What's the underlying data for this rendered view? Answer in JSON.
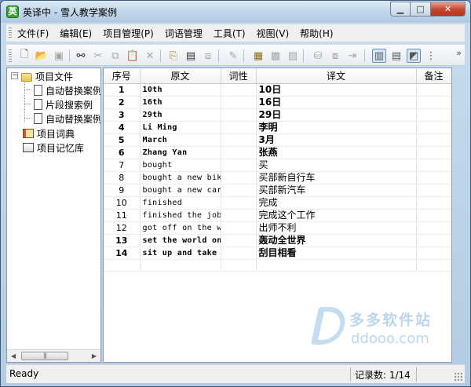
{
  "window": {
    "title": "英译中 - 雪人教学案例",
    "app_icon_letter": "英"
  },
  "menu": [
    "文件(F)",
    "编辑(E)",
    "项目管理(P)",
    "词语管理",
    "工具(T)",
    "视图(V)",
    "帮助(H)"
  ],
  "toolbar": {
    "icons": [
      "new-file-icon",
      "open-folder-icon",
      "save-icon",
      "find-icon",
      "cut-icon",
      "copy-icon",
      "paste-icon",
      "delete-icon",
      "add-doc-icon",
      "add-sentence-icon",
      "import-icon",
      "edit-icon",
      "dictionary-icon",
      "memory-icon",
      "clipboard-icon",
      "database-icon",
      "merge-icon",
      "export-icon",
      "view-left-right-icon",
      "view-top-bottom-icon",
      "view-grid-icon",
      "view-tree-icon"
    ],
    "overflow_glyph": "»"
  },
  "tree": {
    "root_label": "项目文件",
    "children": [
      "自动替换案例",
      "片段搜索例",
      "自动替换案例"
    ],
    "dictionary_label": "项目词典",
    "memory_label": "项目记忆库"
  },
  "grid": {
    "columns": [
      "序号",
      "原文",
      "词性",
      "译文",
      "备注"
    ],
    "rows": [
      {
        "n": "1",
        "src": "10th",
        "pos": "",
        "tgt": "10日",
        "note": "",
        "bold": true
      },
      {
        "n": "2",
        "src": "16th",
        "pos": "",
        "tgt": "16日",
        "note": "",
        "bold": true
      },
      {
        "n": "3",
        "src": "29th",
        "pos": "",
        "tgt": "29日",
        "note": "",
        "bold": true
      },
      {
        "n": "4",
        "src": "Li Ming",
        "pos": "",
        "tgt": "李明",
        "note": "",
        "bold": true
      },
      {
        "n": "5",
        "src": "March",
        "pos": "",
        "tgt": "3月",
        "note": "",
        "bold": true
      },
      {
        "n": "6",
        "src": "Zhang Yan",
        "pos": "",
        "tgt": "张燕",
        "note": "",
        "bold": true
      },
      {
        "n": "7",
        "src": "bought",
        "pos": "",
        "tgt": "买",
        "note": "",
        "bold": false
      },
      {
        "n": "8",
        "src": "bought a new bike",
        "pos": "",
        "tgt": "买部新自行车",
        "note": "",
        "bold": false
      },
      {
        "n": "9",
        "src": "bought a new car",
        "pos": "",
        "tgt": "买部新汽车",
        "note": "",
        "bold": false
      },
      {
        "n": "10",
        "src": "finished",
        "pos": "",
        "tgt": "完成",
        "note": "",
        "bold": false
      },
      {
        "n": "11",
        "src": "finished the job",
        "pos": "",
        "tgt": "完成这个工作",
        "note": "",
        "bold": false
      },
      {
        "n": "12",
        "src": "got off on the wrong foot",
        "pos": "",
        "tgt": "出师不利",
        "note": "",
        "bold": false
      },
      {
        "n": "13",
        "src": "set the world on fire",
        "pos": "",
        "tgt": "轰动全世界",
        "note": "",
        "bold": true
      },
      {
        "n": "14",
        "src": "sit up and take notice",
        "pos": "",
        "tgt": "刮目相看",
        "note": "",
        "bold": true
      }
    ]
  },
  "watermark": {
    "cn": "多多软件站",
    "en": "ddooo.com"
  },
  "status": {
    "text": "Ready",
    "count": "记录数: 1/14"
  },
  "colors": {
    "title_bg": "#c2d6ea",
    "close_button": "#c74a33",
    "watermark": "#bcd6ee"
  }
}
